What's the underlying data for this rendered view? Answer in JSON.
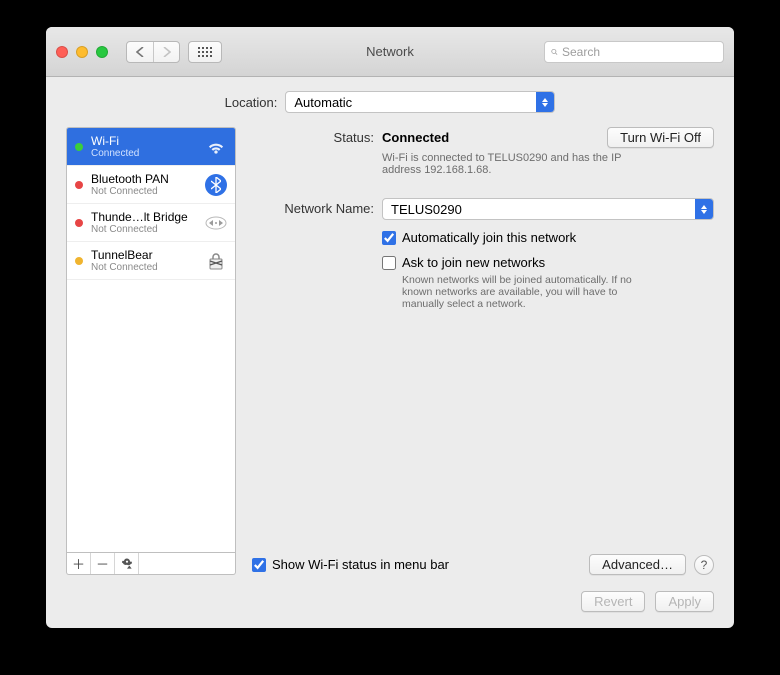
{
  "window_title": "Network",
  "search": {
    "placeholder": "Search"
  },
  "location": {
    "label": "Location:",
    "value": "Automatic"
  },
  "sidebar": {
    "items": [
      {
        "name": "Wi-Fi",
        "status": "Connected",
        "dot": "green",
        "active": true
      },
      {
        "name": "Bluetooth PAN",
        "status": "Not Connected",
        "dot": "red"
      },
      {
        "name": "Thunde…lt Bridge",
        "status": "Not Connected",
        "dot": "red"
      },
      {
        "name": "TunnelBear",
        "status": "Not Connected",
        "dot": "orange"
      }
    ]
  },
  "detail": {
    "status_label": "Status:",
    "status_value": "Connected",
    "toggle_btn": "Turn Wi-Fi Off",
    "status_desc": "Wi-Fi is connected to TELUS0290 and has the IP address 192.168.1.68.",
    "network_label": "Network Name:",
    "network_value": "TELUS0290",
    "auto_join_label": "Automatically join this network",
    "auto_join_checked": true,
    "ask_join_label": "Ask to join new networks",
    "ask_join_checked": false,
    "ask_hint": "Known networks will be joined automatically. If no known networks are available, you will have to manually select a network.",
    "show_menubar_label": "Show Wi-Fi status in menu bar",
    "show_menubar_checked": true,
    "advanced_btn": "Advanced…"
  },
  "footer": {
    "revert": "Revert",
    "apply": "Apply"
  }
}
